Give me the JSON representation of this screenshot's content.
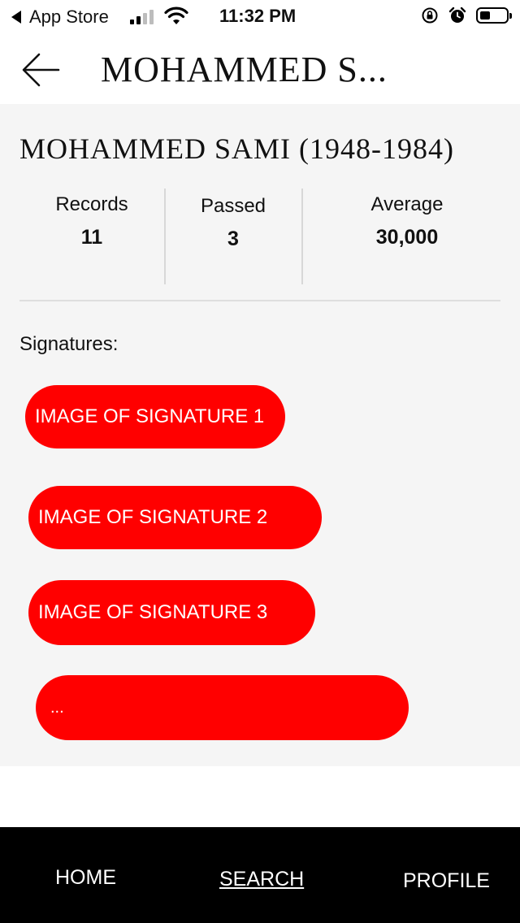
{
  "status_bar": {
    "back_app": "App Store",
    "time": "11:32 PM",
    "signal_bars": 2,
    "battery_level": 0.25
  },
  "nav": {
    "title": "MOHAMMED S...",
    "back_icon": "arrow-left-icon"
  },
  "person": {
    "title": "MOHAMMED SAMI (1948-1984)"
  },
  "stats": {
    "records_label": "Records",
    "records_value": "11",
    "passed_label": "Passed",
    "passed_value": "3",
    "average_label": "Average",
    "average_value": "30,000"
  },
  "signatures": {
    "heading": "Signatures:",
    "items": [
      "IMAGE OF SIGNATURE 1",
      "IMAGE OF SIGNATURE 2",
      "IMAGE OF SIGNATURE 3",
      "..."
    ],
    "button_color": "#ff0000"
  },
  "tabs": {
    "home": "HOME",
    "search": "SEARCH",
    "profile": "PROFILE",
    "active": "SEARCH"
  }
}
